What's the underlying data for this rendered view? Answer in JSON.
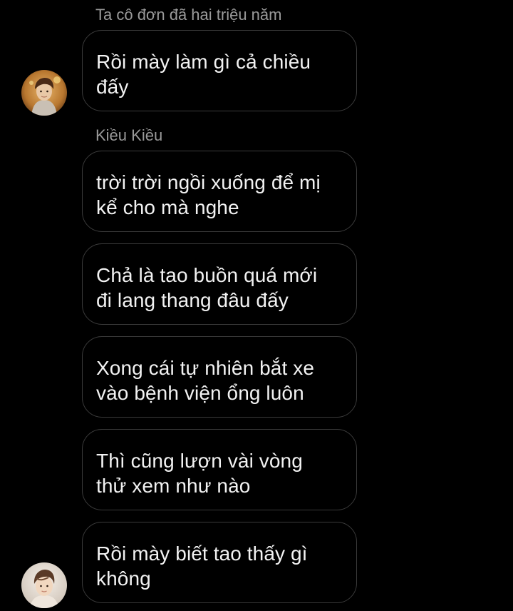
{
  "theme": {
    "background": "#000000",
    "bubble_border": "#3a3a3a",
    "sender_color": "#9a9a9a",
    "text_color": "#f2f2f2"
  },
  "groups": [
    {
      "sender": "Ta cô đơn đã hai triệu năm",
      "avatar": "user-photo-avatar",
      "messages": [
        "Rồi mày làm gì cả chiều\nđấy"
      ]
    },
    {
      "sender": "Kiều Kiều",
      "avatar": "user-photo-avatar",
      "messages": [
        "trời trời ngồi xuống để mị\nkể cho mà nghe",
        "Chả là tao buồn quá mới\nđi lang thang đâu đấy",
        "Xong cái tự nhiên bắt xe\nvào bệnh viện ổng luôn",
        "Thì cũng lượn vài vòng\nthử xem như nào",
        "Rồi mày biết tao thấy gì\nkhông"
      ]
    }
  ]
}
